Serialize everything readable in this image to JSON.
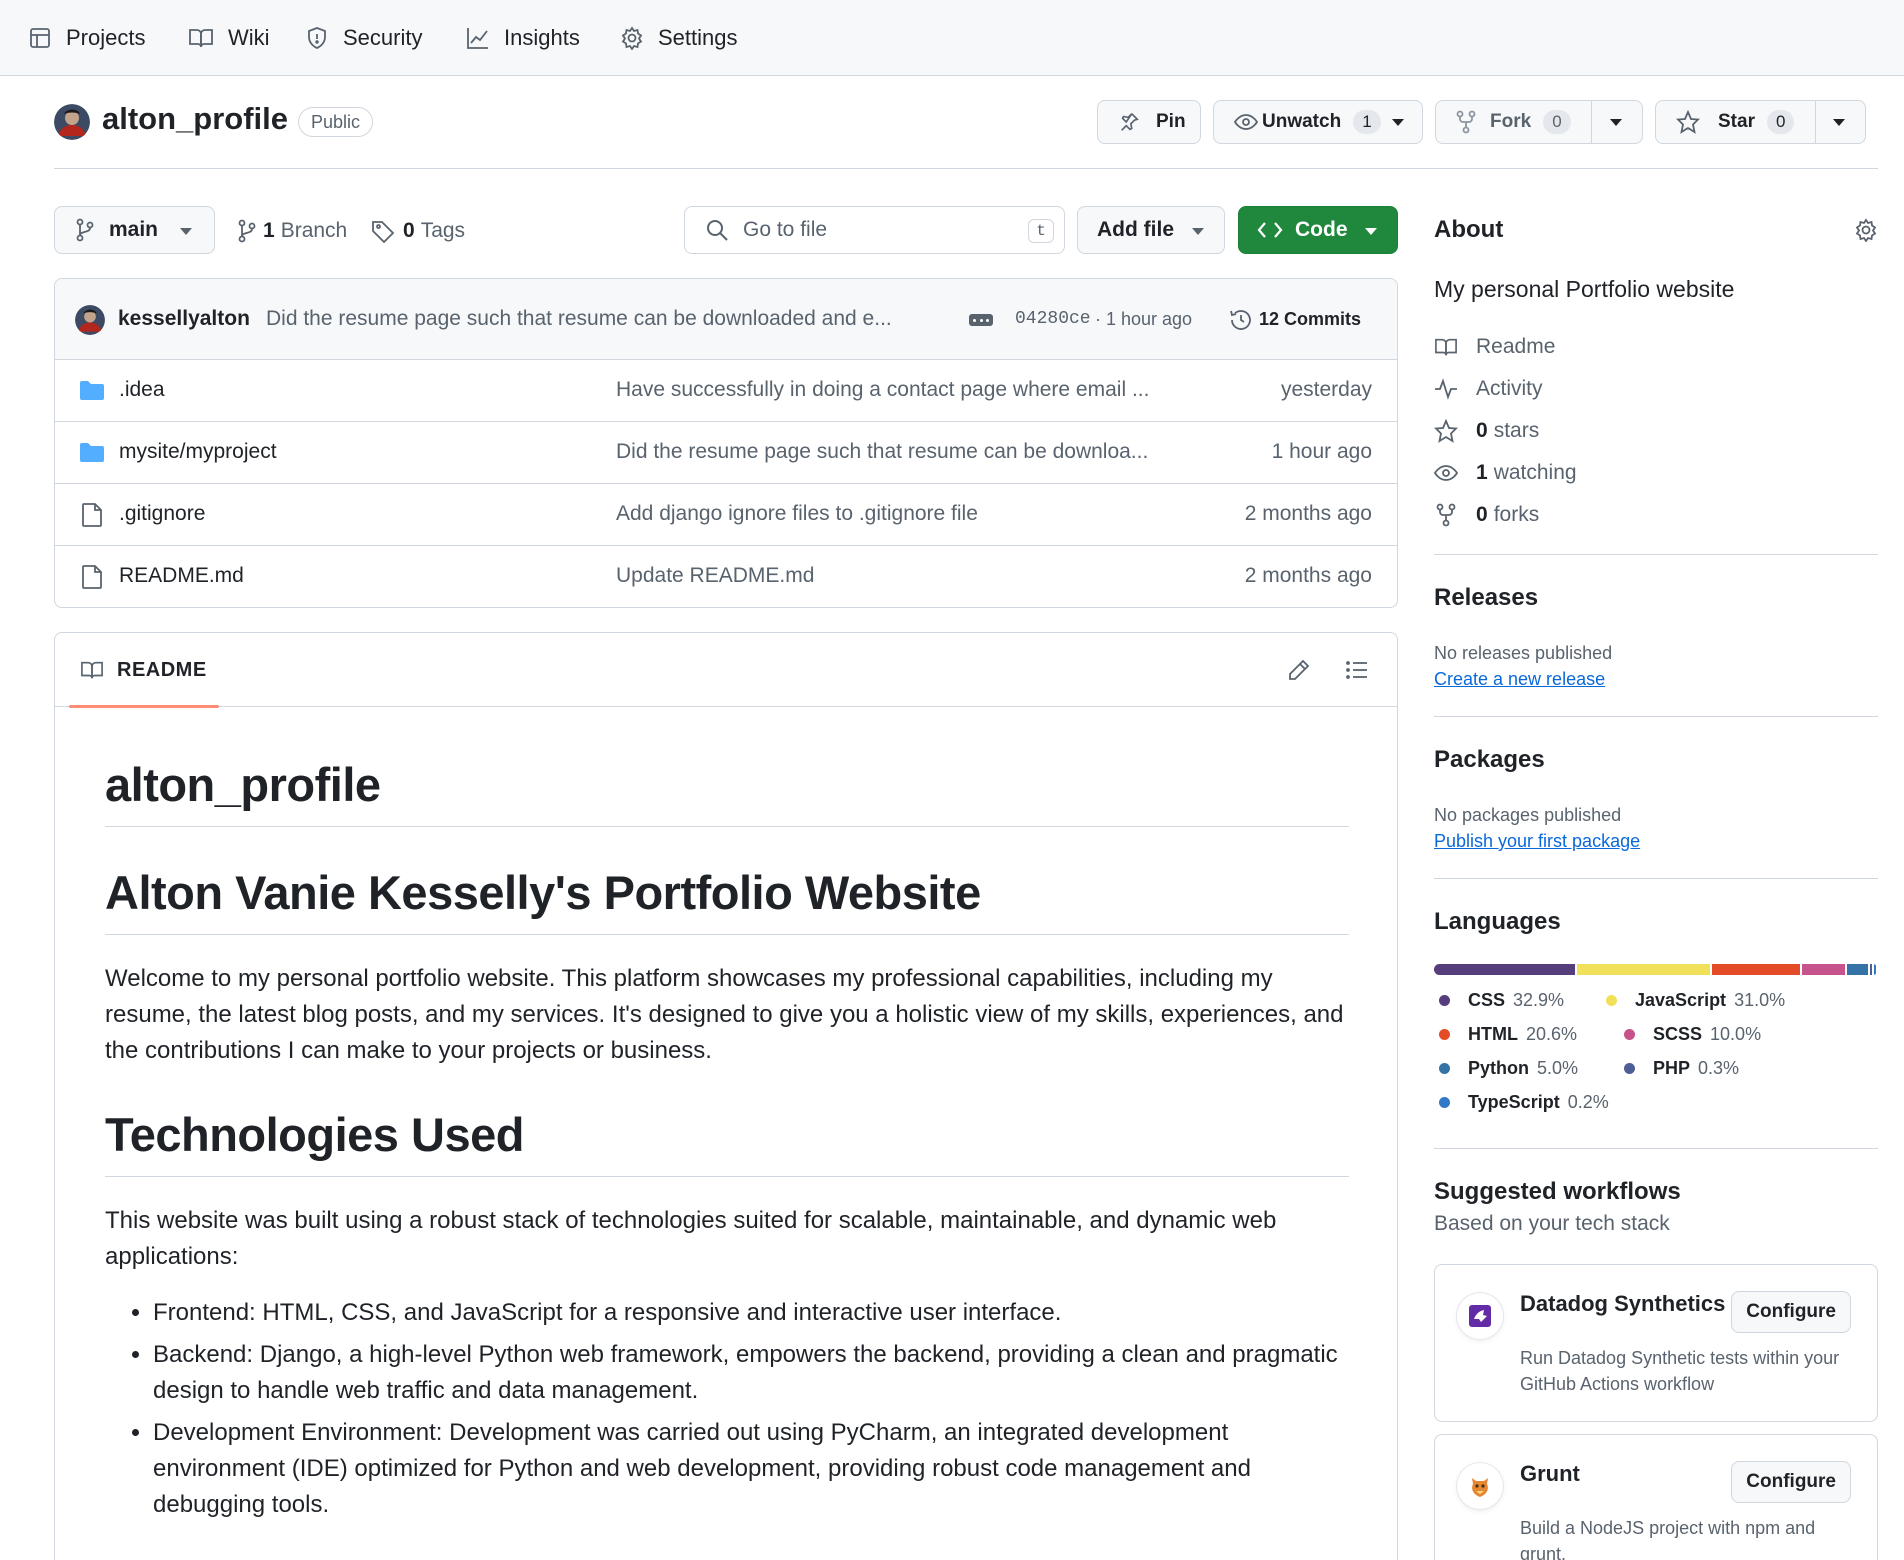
{
  "nav": {
    "items": [
      {
        "label": "Projects",
        "icon": "table-icon"
      },
      {
        "label": "Wiki",
        "icon": "book-icon"
      },
      {
        "label": "Security",
        "icon": "shield-icon"
      },
      {
        "label": "Insights",
        "icon": "graph-icon"
      },
      {
        "label": "Settings",
        "icon": "gear-icon"
      }
    ]
  },
  "repo": {
    "name": "alton_profile",
    "visibility": "Public",
    "pin_label": "Pin",
    "unwatch_label": "Unwatch",
    "watch_count": "1",
    "fork_label": "Fork",
    "fork_count": "0",
    "star_label": "Star",
    "star_count": "0"
  },
  "toolbar": {
    "branch": "main",
    "branch_count": "1",
    "branch_label": "Branch",
    "tag_count": "0",
    "tag_label": "Tags",
    "search_placeholder": "Go to file",
    "search_key": "t",
    "add_file_label": "Add file",
    "code_label": "Code"
  },
  "commit": {
    "author": "kessellyalton",
    "message": "Did the resume page such that resume can be downloaded and e...",
    "sha": "04280ce",
    "time": "· 1 hour ago",
    "commits_label": "12 Commits"
  },
  "files": [
    {
      "type": "folder",
      "name": ".idea",
      "message": "Have successfully in doing a contact page where email ...",
      "time": "yesterday"
    },
    {
      "type": "folder",
      "name": "mysite/myproject",
      "message": "Did the resume page such that resume can be downloa...",
      "time": "1 hour ago"
    },
    {
      "type": "file",
      "name": ".gitignore",
      "message": "Add django ignore files to .gitignore file",
      "time": "2 months ago"
    },
    {
      "type": "file",
      "name": "README.md",
      "message": "Update README.md",
      "time": "2 months ago"
    }
  ],
  "readme": {
    "tab_label": "README",
    "h1": "alton_profile",
    "h2": "Alton Vanie Kesselly's Portfolio Website",
    "intro": "Welcome to my personal portfolio website. This platform showcases my professional capabilities, including my resume, the latest blog posts, and my services. It's designed to give you a holistic view of my skills, experiences, and the contributions I can make to your projects or business.",
    "h3": "Technologies Used",
    "tech_intro": "This website was built using a robust stack of technologies suited for scalable, maintainable, and dynamic web applications:",
    "bullets": [
      "Frontend: HTML, CSS, and JavaScript for a responsive and interactive user interface.",
      "Backend: Django, a high-level Python web framework, empowers the backend, providing a clean and pragmatic design to handle web traffic and data management.",
      "Development Environment: Development was carried out using PyCharm, an integrated development environment (IDE) optimized for Python and web development, providing robust code management and debugging tools."
    ]
  },
  "about": {
    "title": "About",
    "description": "My personal Portfolio website",
    "readme": "Readme",
    "activity": "Activity",
    "stars_count": "0",
    "stars_label": "stars",
    "watching_count": "1",
    "watching_label": "watching",
    "forks_count": "0",
    "forks_label": "forks"
  },
  "releases": {
    "title": "Releases",
    "empty": "No releases published",
    "link": "Create a new release"
  },
  "packages": {
    "title": "Packages",
    "empty": "No packages published",
    "link": "Publish your first package"
  },
  "languages": {
    "title": "Languages",
    "items": [
      {
        "name": "CSS",
        "percent": 32.9,
        "label": "32.9%",
        "color": "#563d7c"
      },
      {
        "name": "JavaScript",
        "percent": 31.0,
        "label": "31.0%",
        "color": "#f1e05a"
      },
      {
        "name": "HTML",
        "percent": 20.6,
        "label": "20.6%",
        "color": "#e34c26"
      },
      {
        "name": "SCSS",
        "percent": 10.0,
        "label": "10.0%",
        "color": "#c6538c"
      },
      {
        "name": "Python",
        "percent": 5.0,
        "label": "5.0%",
        "color": "#3572a5"
      },
      {
        "name": "PHP",
        "percent": 0.3,
        "label": "0.3%",
        "color": "#4f5d95"
      },
      {
        "name": "TypeScript",
        "percent": 0.2,
        "label": "0.2%",
        "color": "#3178c6"
      }
    ]
  },
  "workflows": {
    "title": "Suggested workflows",
    "subtitle": "Based on your tech stack",
    "items": [
      {
        "name": "Datadog Synthetics",
        "description": "Run Datadog Synthetic tests within your GitHub Actions workflow",
        "button": "Configure",
        "icon": "datadog-icon"
      },
      {
        "name": "Grunt",
        "description": "Build a NodeJS project with npm and grunt.",
        "button": "Configure",
        "icon": "grunt-icon"
      }
    ]
  },
  "colors": {
    "accent_green": "#1f883d",
    "link_blue": "#0969da",
    "folder_blue": "#54aeff",
    "tab_underline": "#fd8c73"
  }
}
